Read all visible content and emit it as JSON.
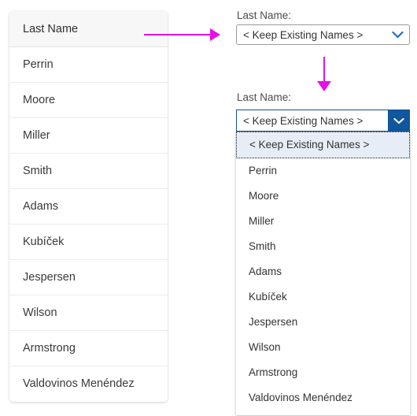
{
  "table": {
    "header": "Last Name",
    "rows": [
      "Perrin",
      "Moore",
      "Miller",
      "Smith",
      "Adams",
      "Kubíček",
      "Jespersen",
      "Wilson",
      "Armstrong",
      "Valdovinos Menéndez"
    ]
  },
  "combo_closed": {
    "label": "Last Name:",
    "value": "< Keep Existing Names >",
    "icon": "chevron-down-icon"
  },
  "combo_open": {
    "label": "Last Name:",
    "value": "< Keep Existing Names >",
    "icon": "chevron-down-icon",
    "options": [
      "< Keep Existing Names >",
      "Perrin",
      "Moore",
      "Miller",
      "Smith",
      "Adams",
      "Kubíček",
      "Jespersen",
      "Wilson",
      "Armstrong",
      "Valdovinos Menéndez"
    ],
    "selected_index": 0
  },
  "annotations": {
    "arrow_horizontal": "arrow-right-icon",
    "arrow_vertical": "arrow-down-icon",
    "accent_color": "#e810e8"
  },
  "colors": {
    "combo_button_blue": "#11579d",
    "combo_open_border": "#10538f",
    "chevron_blue": "#1a6bbd",
    "highlight_bg": "#e6edf6",
    "table_header_bg": "#f7f7f7"
  }
}
